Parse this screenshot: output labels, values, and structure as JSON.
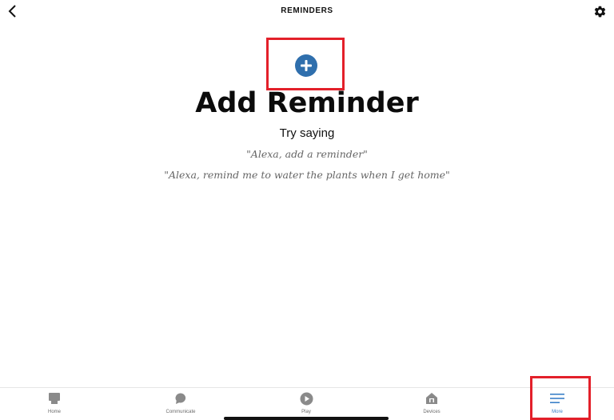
{
  "header": {
    "title": "REMINDERS",
    "back_icon": "chevron-left-icon",
    "settings_icon": "gear-icon"
  },
  "main": {
    "add_icon": "plus-circle-icon",
    "title": "Add Reminder",
    "subtitle": "Try saying",
    "examples": [
      "\"Alexa, add a reminder\"",
      "\"Alexa, remind me to water the plants when I get home\""
    ]
  },
  "bottom_nav": {
    "items": [
      {
        "label": "Home",
        "icon": "home-icon",
        "active": false
      },
      {
        "label": "Communicate",
        "icon": "chat-bubble-icon",
        "active": false
      },
      {
        "label": "Play",
        "icon": "play-icon",
        "active": false
      },
      {
        "label": "Devices",
        "icon": "devices-house-icon",
        "active": false
      },
      {
        "label": "More",
        "icon": "menu-icon",
        "active": true
      }
    ]
  },
  "colors": {
    "accent": "#2f6fad",
    "active_nav": "#3a80c8",
    "highlight": "#e3202a",
    "icon_gray": "#8a8a8a"
  }
}
